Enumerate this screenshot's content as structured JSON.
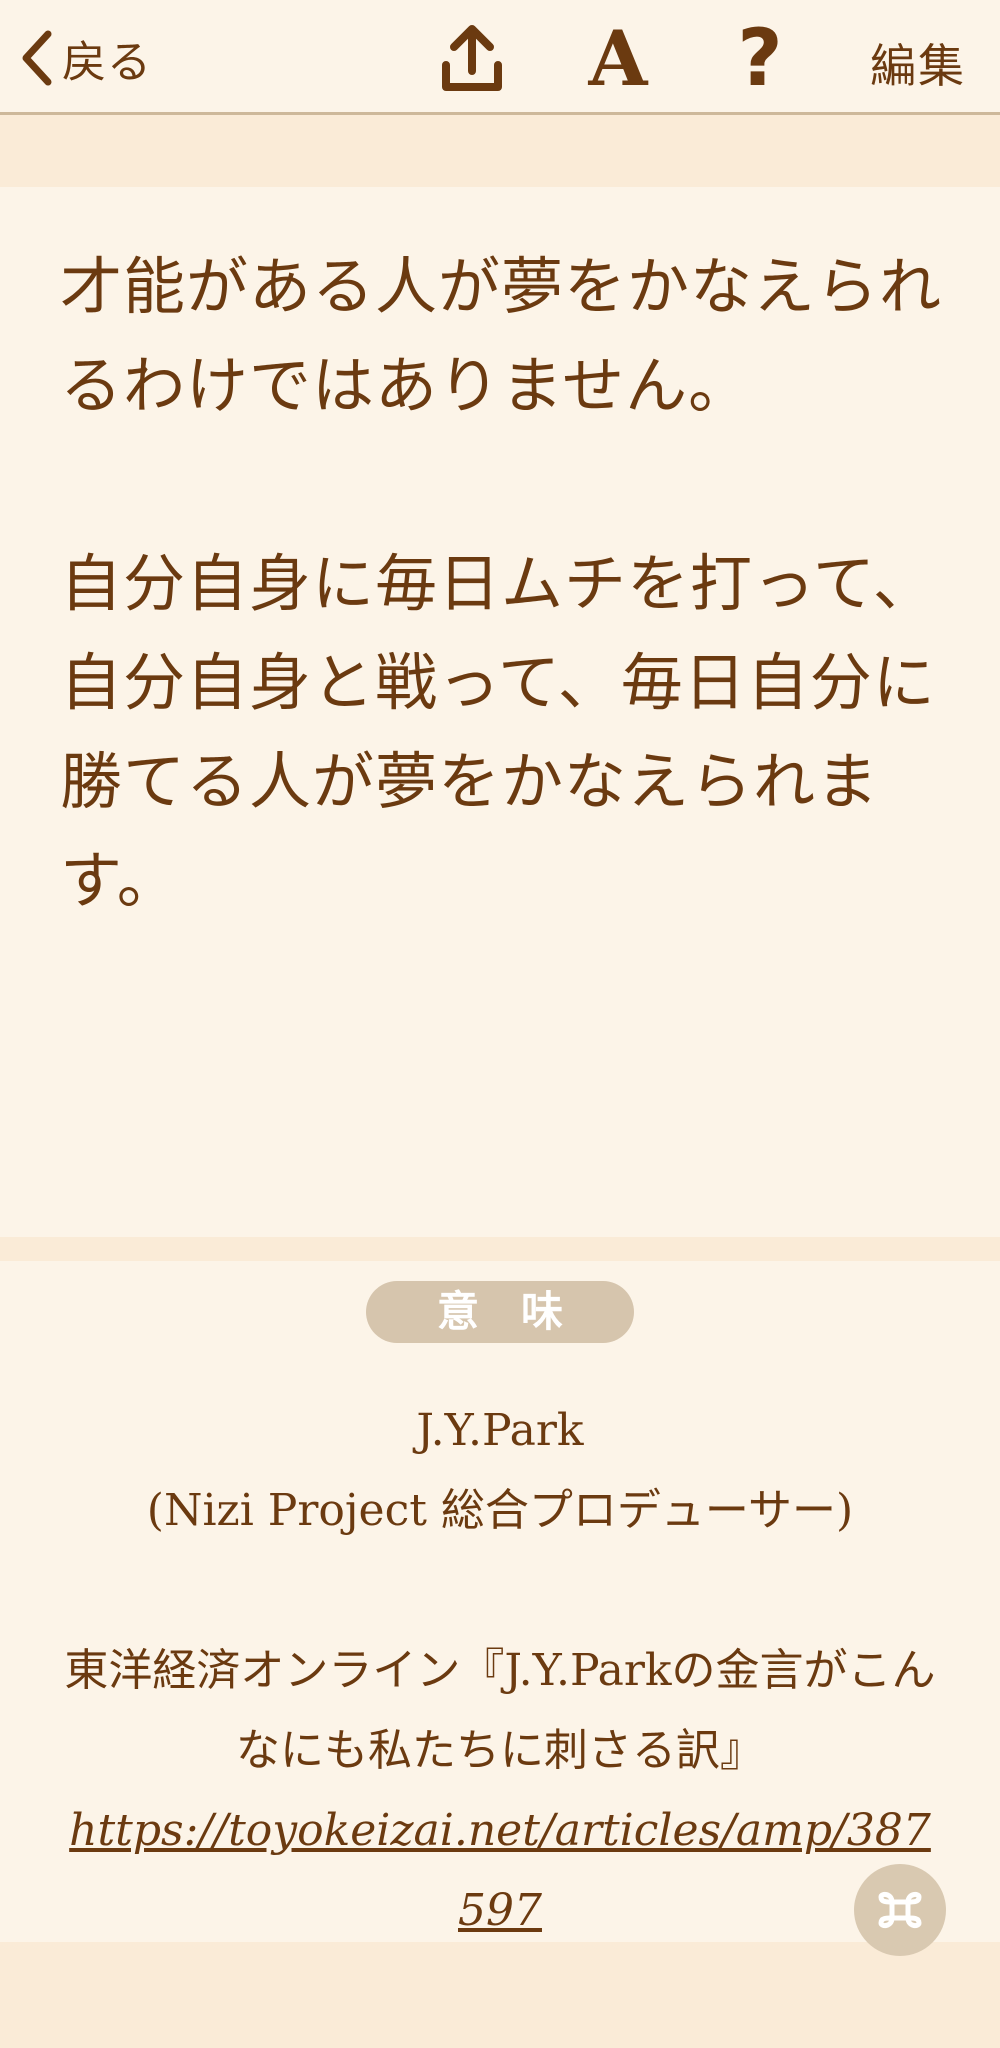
{
  "toolbar": {
    "back_label": "戻る",
    "edit_label": "編集",
    "font_icon_glyph": "A",
    "help_icon_glyph": "?"
  },
  "quote": {
    "paragraph_1": "才能がある人が夢をかなえられるわけではありません。",
    "paragraph_2": "自分自身に毎日ムチを打って、自分自身と戦って、毎日自分に勝てる人が夢をかなえられます。"
  },
  "meaning": {
    "badge_label": "意味",
    "author": "J.Y.Park",
    "author_role": "(Nizi Project 総合プロデューサー)",
    "source_title": "東洋経済オンライン『J.Y.Parkの金言がこんなにも私たちに刺さる訳』",
    "source_url": "https://toyokeizai.net/articles/amp/387597"
  },
  "icons": {
    "back": "chevron-left-icon",
    "share": "share-upload-icon",
    "font": "font-size-icon",
    "help": "help-question-icon",
    "command": "command-key-icon"
  },
  "colors": {
    "text_brown": "#6b3a10",
    "card_background": "#fcf4e8",
    "page_background": "#faebd7",
    "badge_background": "#d6c5ad"
  }
}
